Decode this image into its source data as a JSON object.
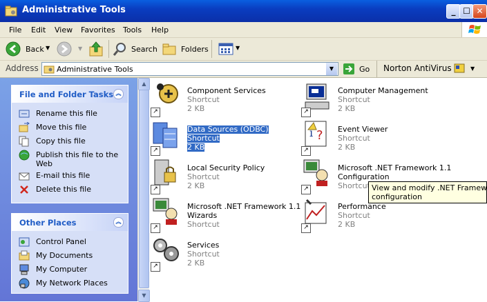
{
  "window": {
    "title": "Administrative Tools"
  },
  "menu": [
    "File",
    "Edit",
    "View",
    "Favorites",
    "Tools",
    "Help"
  ],
  "toolbar": {
    "back": "Back",
    "search": "Search",
    "folders": "Folders"
  },
  "address": {
    "label": "Address",
    "value": "Administrative Tools",
    "go": "Go",
    "antivirus": "Norton AntiVirus"
  },
  "file_tasks": {
    "title": "File and Folder Tasks",
    "items": [
      "Rename this file",
      "Move this file",
      "Copy this file",
      "Publish this file to the Web",
      "E-mail this file",
      "Delete this file"
    ]
  },
  "other_places": {
    "title": "Other Places",
    "items": [
      "Control Panel",
      "My Documents",
      "My Computer",
      "My Network Places"
    ]
  },
  "files": [
    {
      "name": "Component Services",
      "type": "Shortcut",
      "size": "2 KB"
    },
    {
      "name": "Computer Management",
      "type": "Shortcut",
      "size": "2 KB"
    },
    {
      "name": "Data Sources (ODBC)",
      "type": "Shortcut",
      "size": "2 KB"
    },
    {
      "name": "Event Viewer",
      "type": "Shortcut",
      "size": "2 KB"
    },
    {
      "name": "Local Security Policy",
      "type": "Shortcut",
      "size": "2 KB"
    },
    {
      "name_line1": "Microsoft .NET Framework 1.1",
      "name_line2": "Configuration",
      "type": "Shortcut"
    },
    {
      "name_line1": "Microsoft .NET Framework 1.1",
      "name_line2": "Wizards",
      "type": "Shortcut"
    },
    {
      "name": "Performance",
      "type": "Shortcut",
      "size": "2 KB"
    },
    {
      "name": "Services",
      "type": "Shortcut",
      "size": "2 KB"
    }
  ],
  "tooltip": {
    "line1": "View and modify .NET Framework s",
    "line2": "configuration"
  },
  "colors": {
    "title_blue": "#0a3dc0",
    "selection": "#316ac5",
    "panel_heading": "#215dc6"
  }
}
